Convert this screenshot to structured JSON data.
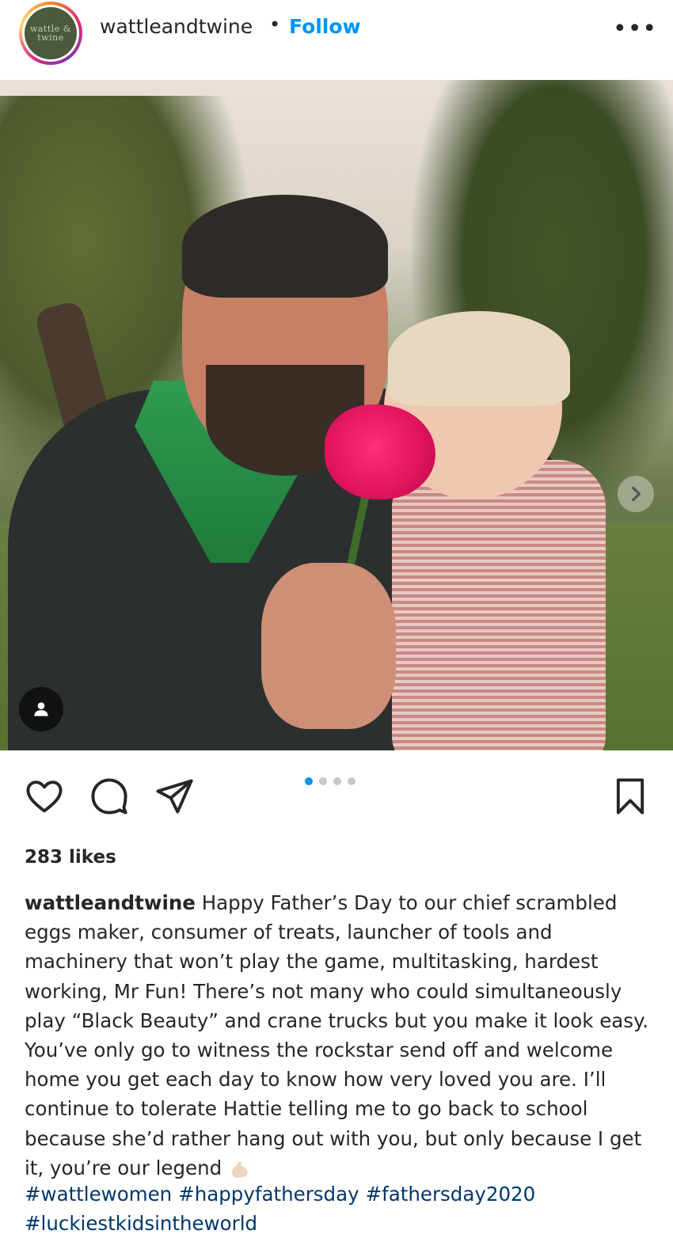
{
  "header": {
    "username": "wattleandtwine",
    "separator": "•",
    "follow_label": "Follow",
    "more_label": "•••",
    "avatar_logo": "wattle & twine"
  },
  "post": {
    "carousel": {
      "pages": 4,
      "current": 1
    },
    "likes": "283 likes",
    "caption_user": "wattleandtwine",
    "caption_text": "Happy Father’s Day to our chief scrambled eggs maker, consumer of treats, launcher of tools and machinery that won’t play the game, multitasking, hardest working, Mr Fun! There’s not many who could simultaneously play “Black Beauty” and crane trucks but you make it look easy. You’ve only go to witness the rockstar send off and welcome home you get each day to know how very loved you are. I’ll continue to tolerate Hattie telling me to go back to school because she’d rather hang out with you, but only because I get it, you’re our legend",
    "emoji": "flexed-biceps",
    "hashtags": [
      "#wattlewomen",
      "#happyfathersday",
      "#fathersday2020",
      "#luckiestkidsintheworld"
    ]
  },
  "colors": {
    "link_blue": "#0095f6",
    "hashtag_blue": "#00376b",
    "text": "#262626"
  },
  "icons": {
    "like": "heart-icon",
    "comment": "comment-icon",
    "share": "send-icon",
    "save": "bookmark-icon",
    "next": "chevron-right-icon",
    "tags": "user-tag-icon"
  }
}
